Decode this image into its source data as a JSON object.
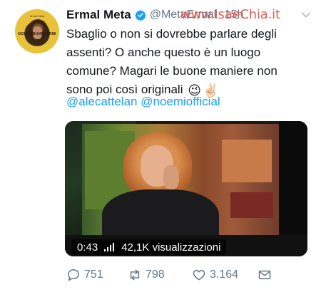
{
  "tweet": {
    "display_name": "Ermal Meta",
    "handle": "@MetaErmal",
    "dot": "·",
    "time": "15h",
    "verified": true,
    "text_lines": [
      "Sbaglio o non si dovrebbe parlare degli",
      "assenti? O anche questo è un luogo",
      "comune? Magari le buone maniere non",
      "sono poi così originali"
    ],
    "emojis": [
      "😉",
      "✌🏻"
    ],
    "mentions": [
      "@alecattelan",
      "@noemiofficial"
    ]
  },
  "avatar": {
    "caption_top": "Ermal Meta",
    "caption": "NON ABBIAMO ARMI"
  },
  "watermark": "www.IsaeChia.it",
  "video": {
    "duration": "0:43",
    "views": "42,1K visualizzazioni"
  },
  "actions": {
    "replies": "751",
    "retweets": "798",
    "likes": "3.164"
  },
  "icons": {
    "verified": "verified-badge-icon",
    "menu": "chevron-down-icon",
    "reply": "reply-icon",
    "retweet": "retweet-icon",
    "like": "heart-icon",
    "message": "envelope-icon",
    "signal": "signal-bars-icon"
  },
  "colors": {
    "accent": "#1da1f2",
    "muted": "#657786",
    "text": "#14171a",
    "watermark": "#d9534f"
  }
}
